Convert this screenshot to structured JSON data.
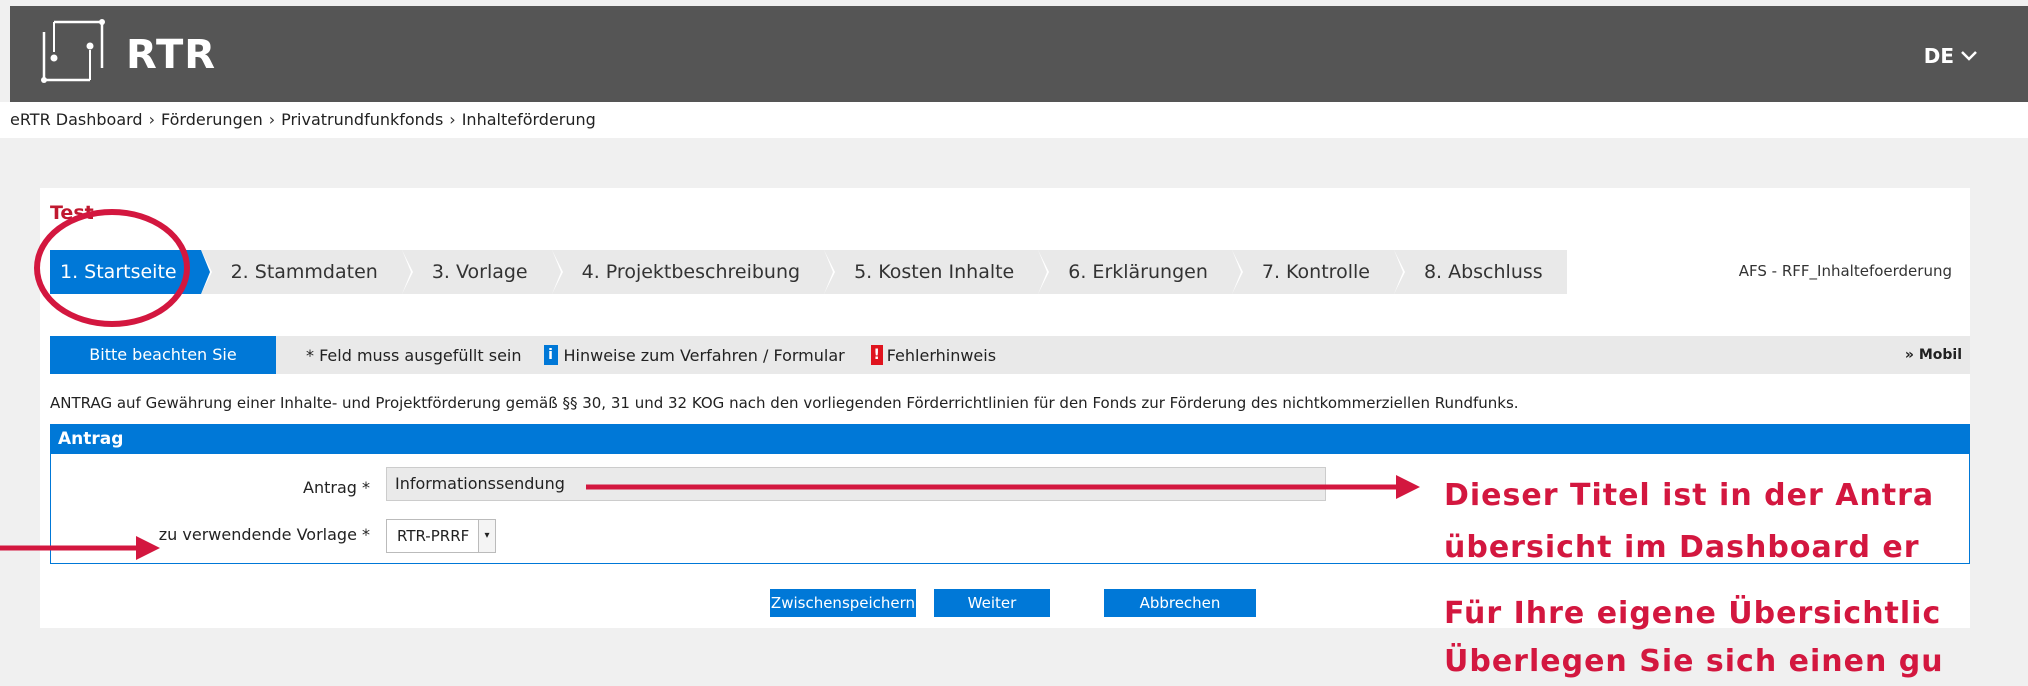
{
  "header": {
    "brand": "RTR",
    "language": "DE"
  },
  "breadcrumb": [
    "eRTR Dashboard",
    "Förderungen",
    "Privatrundfunkfonds",
    "Inhalteförderung"
  ],
  "page": {
    "title": "Test",
    "form_id": "AFS - RFF_Inhaltefoerderung",
    "tabs": [
      "1. Startseite",
      "2. Stammdaten",
      "3. Vorlage",
      "4. Projektbeschreibung",
      "5. Kosten Inhalte",
      "6. Erklärungen",
      "7. Kontrolle",
      "8. Abschluss"
    ]
  },
  "info_bar": {
    "notice_button": "Bitte beachten Sie",
    "required_legend": "* Feld muss ausgefüllt sein",
    "hint_icon": "i",
    "hint_legend": "Hinweise zum Verfahren / Formular",
    "error_icon": "!",
    "error_legend": "Fehlerhinweis",
    "mobile_link": "» Mobil"
  },
  "intro_text": "ANTRAG auf Gewährung einer Inhalte- und Projektförderung gemäß §§ 30, 31 und 32 KOG nach den vorliegenden Förderrichtlinien für den Fonds zur Förderung des nichtkommerziellen Rundfunks.",
  "section": {
    "title": "Antrag",
    "antrag_label": "Antrag *",
    "antrag_value": "Informationssendung",
    "vorlage_label": "zu verwendende Vorlage *",
    "vorlage_value": "RTR-PRRF"
  },
  "buttons": {
    "save": "Zwischenspeichern",
    "next": "Weiter",
    "cancel": "Abbrechen"
  },
  "annotations": {
    "line1": "Dieser Titel ist in der Antra",
    "line2": "übersicht im Dashboard er",
    "line3": "Für Ihre eigene Übersichtlic",
    "line4": "Überlegen Sie sich einen gu"
  },
  "colors": {
    "accent": "#0078d7",
    "annotation": "#d3173f",
    "header": "#555555"
  }
}
